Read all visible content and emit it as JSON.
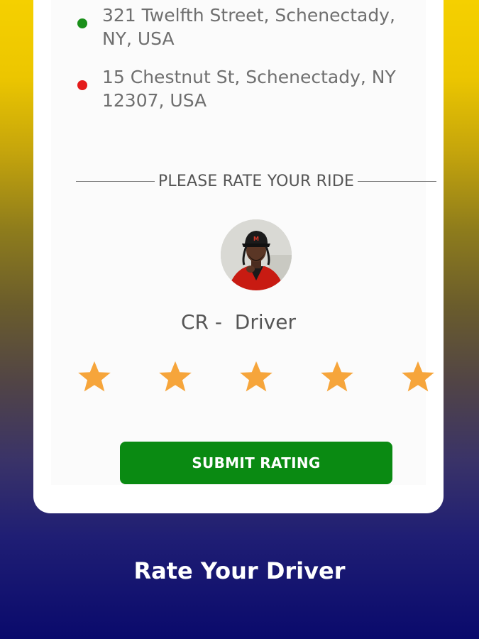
{
  "trip": {
    "pickup": {
      "address": "321 Twelfth Street, Schenectady, NY, USA",
      "dot_color": "#1a8f1a"
    },
    "dropoff": {
      "address": "15 Chestnut St, Schenectady, NY 12307, USA",
      "dot_color": "#e41b1b"
    }
  },
  "rating": {
    "section_label": "PLEASE RATE YOUR RIDE",
    "driver_name": "CR -  Driver",
    "star_count": 5,
    "selected_stars": 5,
    "star_color": "#f6a53b",
    "submit_label": "SUBMIT RATING",
    "submit_color": "#0a8a12"
  },
  "caption": "Rate Your Driver"
}
